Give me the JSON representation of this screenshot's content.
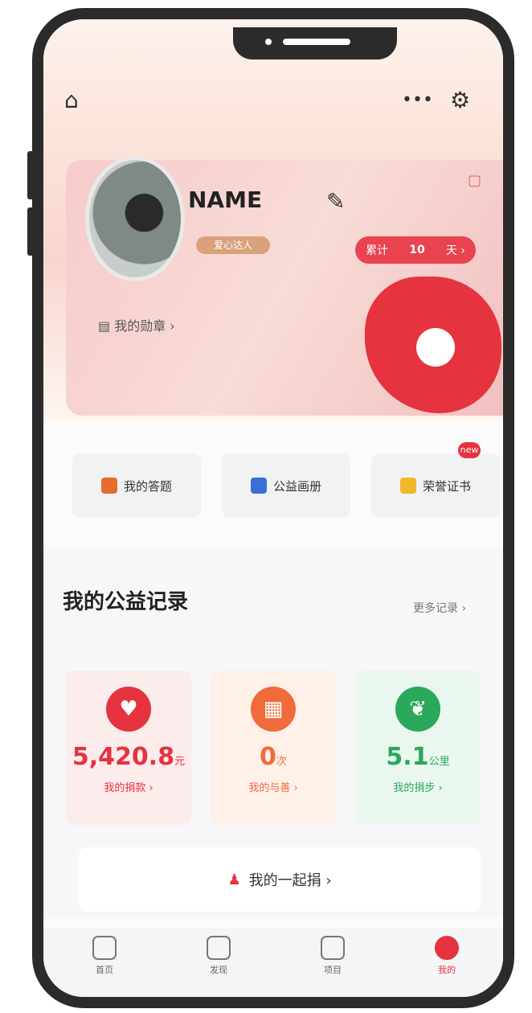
{
  "header": {
    "home_icon": "home-icon",
    "more_icon": "more-icon",
    "settings_icon": "settings-icon"
  },
  "profile": {
    "name": "NAME",
    "badge": "爱心达人",
    "stats": {
      "left": "累计",
      "value": "10",
      "right": "天 ›"
    },
    "link": "我的勋章 ›"
  },
  "shortcuts": [
    {
      "label": "我的答题",
      "color": "#e66b2c"
    },
    {
      "label": "公益画册",
      "color": "#3a6fd8"
    },
    {
      "label": "荣誉证书",
      "color": "#f2b72a"
    }
  ],
  "shortcut_badge": "new",
  "records": {
    "title": "我的公益记录",
    "more": "更多记录 ›",
    "items": [
      {
        "value": "5,420.8",
        "unit": "元",
        "label": "我的捐款 ›",
        "color": "#e5333f",
        "bg": "#fdecec"
      },
      {
        "value": "0",
        "unit": "次",
        "label": "我的与善 ›",
        "color": "#ef6b3b",
        "bg": "#fff0e8"
      },
      {
        "value": "5.1",
        "unit": "公里",
        "label": "我的捐步 ›",
        "color": "#2aa85b",
        "bg": "#eaf7ef"
      }
    ],
    "together": "我的一起捐 ›"
  },
  "tabs": [
    {
      "label": "首页"
    },
    {
      "label": "发现"
    },
    {
      "label": "项目"
    },
    {
      "label": "我的",
      "active": true
    }
  ]
}
